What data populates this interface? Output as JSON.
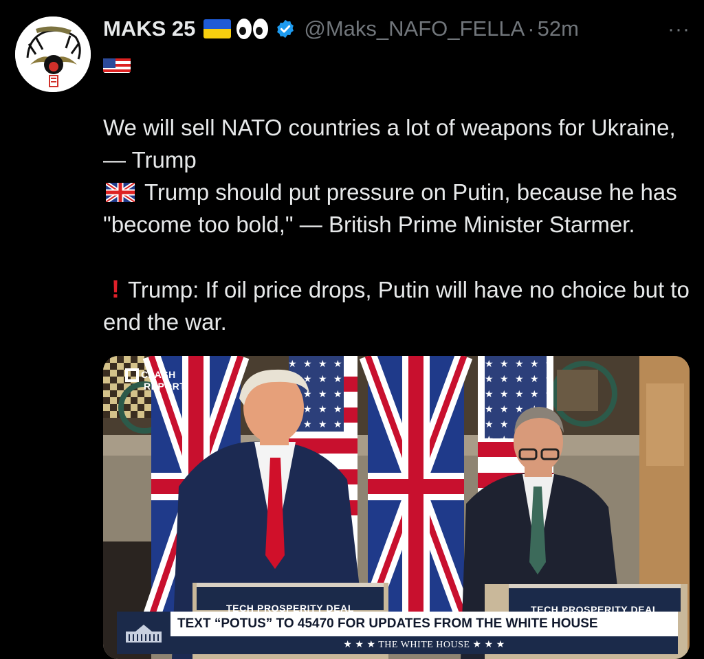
{
  "post": {
    "author": {
      "display_name": "MAKS 25",
      "handle": "@Maks_NAFO_FELLA",
      "time": "52m",
      "badges": [
        "ukraine-flag",
        "eyes",
        "verified-badge"
      ]
    },
    "more_label": "···",
    "paragraphs": [
      {
        "icons": [
          "us-flag",
          "ukraine-flag"
        ],
        "text": "We will sell NATO countries a lot of weapons for Ukraine, — Trump"
      },
      {
        "icons": [
          "uk-flag"
        ],
        "text": "Trump should put pressure on Putin, because he has \"become too bold,\" — British Prime Minister Starmer."
      },
      {
        "icons": [
          "red-exclamation"
        ],
        "text": "Trump: If oil price drops, Putin will have no choice but to end the war."
      }
    ],
    "media": {
      "watermark_line1": "CLASH",
      "watermark_line2": "REPORT",
      "podium_left": "TECH PROSPERITY DEAL",
      "podium_right": "TECH PROSPERITY DEAL",
      "banner_text": "TEXT “POTUS” TO 45470 FOR UPDATES FROM THE WHITE HOUSE",
      "banner_sub": "★ ★ ★   THE WHITE HOUSE   ★ ★ ★"
    }
  },
  "colors": {
    "background": "#000000",
    "text": "#e7e9ea",
    "secondary": "#71767b",
    "verified": "#1d9bf0"
  }
}
